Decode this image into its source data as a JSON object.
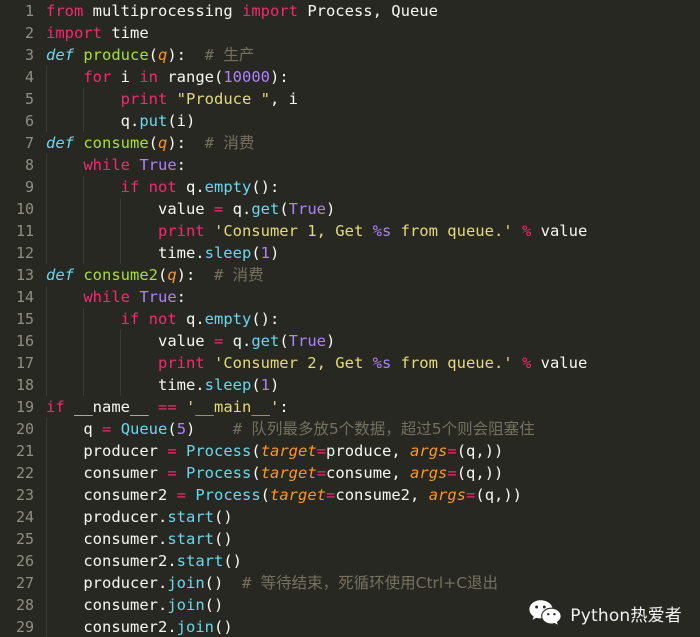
{
  "app": {
    "kind": "code-editor",
    "language": "Python",
    "theme": "Monokai",
    "background_color": "#272822",
    "foreground_color": "#f8f8f2",
    "gutter_color": "#8f8f84",
    "comment_color": "#75715e"
  },
  "palette": {
    "keyword": "#f92672",
    "def_keyword": "#66d9ef",
    "function_name": "#a6e22e",
    "parameter": "#fd971f",
    "class_name": "#66d9ef",
    "number": "#ae81ff",
    "string": "#e6db74",
    "comment": "#75715e",
    "plain": "#f8f8f2"
  },
  "watermark": {
    "icon": "wechat-icon",
    "label": "Python热爱者"
  },
  "editor": {
    "first_line_number": 1,
    "last_line_number": 29,
    "line_count": 29,
    "lines": [
      {
        "n": "1",
        "tokens": [
          {
            "t": "from ",
            "c": "kw"
          },
          {
            "t": "multiprocessing ",
            "c": "plain"
          },
          {
            "t": "import ",
            "c": "kw"
          },
          {
            "t": "Process, Queue",
            "c": "plain"
          }
        ]
      },
      {
        "n": "2",
        "tokens": [
          {
            "t": "import ",
            "c": "kw"
          },
          {
            "t": "time",
            "c": "plain"
          }
        ]
      },
      {
        "n": "3",
        "tokens": [
          {
            "t": "def ",
            "c": "kwdef"
          },
          {
            "t": "produce",
            "c": "fn"
          },
          {
            "t": "(",
            "c": "plain"
          },
          {
            "t": "q",
            "c": "param"
          },
          {
            "t": "):",
            "c": "plain"
          },
          {
            "t": "  # ",
            "c": "cmt"
          },
          {
            "t": "生产",
            "c": "cmt-cn"
          }
        ]
      },
      {
        "n": "4",
        "tokens": [
          {
            "t": "    ",
            "c": "plain"
          },
          {
            "t": "for ",
            "c": "kw"
          },
          {
            "t": "i ",
            "c": "plain"
          },
          {
            "t": "in ",
            "c": "kw"
          },
          {
            "t": "range",
            "c": "plain"
          },
          {
            "t": "(",
            "c": "plain"
          },
          {
            "t": "10000",
            "c": "num"
          },
          {
            "t": "):",
            "c": "plain"
          }
        ]
      },
      {
        "n": "5",
        "tokens": [
          {
            "t": "        ",
            "c": "plain"
          },
          {
            "t": "print ",
            "c": "kw"
          },
          {
            "t": "\"Produce \"",
            "c": "str"
          },
          {
            "t": ", i",
            "c": "plain"
          }
        ]
      },
      {
        "n": "6",
        "tokens": [
          {
            "t": "        q.",
            "c": "plain"
          },
          {
            "t": "put",
            "c": "meth"
          },
          {
            "t": "(i)",
            "c": "plain"
          }
        ]
      },
      {
        "n": "7",
        "tokens": [
          {
            "t": "def ",
            "c": "kwdef"
          },
          {
            "t": "consume",
            "c": "fn"
          },
          {
            "t": "(",
            "c": "plain"
          },
          {
            "t": "q",
            "c": "param"
          },
          {
            "t": "):",
            "c": "plain"
          },
          {
            "t": "  # ",
            "c": "cmt"
          },
          {
            "t": "消费",
            "c": "cmt-cn"
          }
        ]
      },
      {
        "n": "8",
        "tokens": [
          {
            "t": "    ",
            "c": "plain"
          },
          {
            "t": "while ",
            "c": "kw"
          },
          {
            "t": "True",
            "c": "num"
          },
          {
            "t": ":",
            "c": "plain"
          }
        ]
      },
      {
        "n": "9",
        "tokens": [
          {
            "t": "        ",
            "c": "plain"
          },
          {
            "t": "if ",
            "c": "kw"
          },
          {
            "t": "not ",
            "c": "kw"
          },
          {
            "t": "q.",
            "c": "plain"
          },
          {
            "t": "empty",
            "c": "meth"
          },
          {
            "t": "():",
            "c": "plain"
          }
        ]
      },
      {
        "n": "10",
        "tokens": [
          {
            "t": "            value ",
            "c": "plain"
          },
          {
            "t": "=",
            "c": "op"
          },
          {
            "t": " q.",
            "c": "plain"
          },
          {
            "t": "get",
            "c": "meth"
          },
          {
            "t": "(",
            "c": "plain"
          },
          {
            "t": "True",
            "c": "num"
          },
          {
            "t": ")",
            "c": "plain"
          }
        ]
      },
      {
        "n": "11",
        "tokens": [
          {
            "t": "            ",
            "c": "plain"
          },
          {
            "t": "print ",
            "c": "kw"
          },
          {
            "t": "'Consumer 1, Get ",
            "c": "str"
          },
          {
            "t": "%s",
            "c": "strfmt"
          },
          {
            "t": " from queue.'",
            "c": "str"
          },
          {
            "t": " ",
            "c": "plain"
          },
          {
            "t": "%",
            "c": "op"
          },
          {
            "t": " value",
            "c": "plain"
          }
        ]
      },
      {
        "n": "12",
        "tokens": [
          {
            "t": "            time.",
            "c": "plain"
          },
          {
            "t": "sleep",
            "c": "meth"
          },
          {
            "t": "(",
            "c": "plain"
          },
          {
            "t": "1",
            "c": "num"
          },
          {
            "t": ")",
            "c": "plain"
          }
        ]
      },
      {
        "n": "13",
        "tokens": [
          {
            "t": "def ",
            "c": "kwdef"
          },
          {
            "t": "consume2",
            "c": "fn"
          },
          {
            "t": "(",
            "c": "plain"
          },
          {
            "t": "q",
            "c": "param"
          },
          {
            "t": "):",
            "c": "plain"
          },
          {
            "t": "  # ",
            "c": "cmt"
          },
          {
            "t": "消费",
            "c": "cmt-cn"
          }
        ]
      },
      {
        "n": "14",
        "tokens": [
          {
            "t": "    ",
            "c": "plain"
          },
          {
            "t": "while ",
            "c": "kw"
          },
          {
            "t": "True",
            "c": "num"
          },
          {
            "t": ":",
            "c": "plain"
          }
        ]
      },
      {
        "n": "15",
        "tokens": [
          {
            "t": "        ",
            "c": "plain"
          },
          {
            "t": "if ",
            "c": "kw"
          },
          {
            "t": "not ",
            "c": "kw"
          },
          {
            "t": "q.",
            "c": "plain"
          },
          {
            "t": "empty",
            "c": "meth"
          },
          {
            "t": "():",
            "c": "plain"
          }
        ]
      },
      {
        "n": "16",
        "tokens": [
          {
            "t": "            value ",
            "c": "plain"
          },
          {
            "t": "=",
            "c": "op"
          },
          {
            "t": " q.",
            "c": "plain"
          },
          {
            "t": "get",
            "c": "meth"
          },
          {
            "t": "(",
            "c": "plain"
          },
          {
            "t": "True",
            "c": "num"
          },
          {
            "t": ")",
            "c": "plain"
          }
        ]
      },
      {
        "n": "17",
        "tokens": [
          {
            "t": "            ",
            "c": "plain"
          },
          {
            "t": "print ",
            "c": "kw"
          },
          {
            "t": "'Consumer 2, Get ",
            "c": "str"
          },
          {
            "t": "%s",
            "c": "strfmt"
          },
          {
            "t": " from queue.'",
            "c": "str"
          },
          {
            "t": " ",
            "c": "plain"
          },
          {
            "t": "%",
            "c": "op"
          },
          {
            "t": " value",
            "c": "plain"
          }
        ]
      },
      {
        "n": "18",
        "tokens": [
          {
            "t": "            time.",
            "c": "plain"
          },
          {
            "t": "sleep",
            "c": "meth"
          },
          {
            "t": "(",
            "c": "plain"
          },
          {
            "t": "1",
            "c": "num"
          },
          {
            "t": ")",
            "c": "plain"
          }
        ]
      },
      {
        "n": "19",
        "tokens": [
          {
            "t": "if ",
            "c": "kw"
          },
          {
            "t": "__name__ ",
            "c": "plain"
          },
          {
            "t": "==",
            "c": "op"
          },
          {
            "t": " ",
            "c": "plain"
          },
          {
            "t": "'__main__'",
            "c": "str"
          },
          {
            "t": ":",
            "c": "plain"
          }
        ]
      },
      {
        "n": "20",
        "tokens": [
          {
            "t": "    q ",
            "c": "plain"
          },
          {
            "t": "=",
            "c": "op"
          },
          {
            "t": " ",
            "c": "plain"
          },
          {
            "t": "Queue",
            "c": "cls"
          },
          {
            "t": "(",
            "c": "plain"
          },
          {
            "t": "5",
            "c": "num"
          },
          {
            "t": ")",
            "c": "plain"
          },
          {
            "t": "    # ",
            "c": "cmt"
          },
          {
            "t": "队列最多放5个数据，超过5个则会阻塞住",
            "c": "cmt-cn"
          }
        ]
      },
      {
        "n": "21",
        "tokens": [
          {
            "t": "    producer ",
            "c": "plain"
          },
          {
            "t": "=",
            "c": "op"
          },
          {
            "t": " ",
            "c": "plain"
          },
          {
            "t": "Process",
            "c": "cls"
          },
          {
            "t": "(",
            "c": "plain"
          },
          {
            "t": "target",
            "c": "param"
          },
          {
            "t": "=",
            "c": "op"
          },
          {
            "t": "produce, ",
            "c": "plain"
          },
          {
            "t": "args",
            "c": "param"
          },
          {
            "t": "=",
            "c": "op"
          },
          {
            "t": "(q,))",
            "c": "plain"
          }
        ]
      },
      {
        "n": "22",
        "tokens": [
          {
            "t": "    consumer ",
            "c": "plain"
          },
          {
            "t": "=",
            "c": "op"
          },
          {
            "t": " ",
            "c": "plain"
          },
          {
            "t": "Process",
            "c": "cls"
          },
          {
            "t": "(",
            "c": "plain"
          },
          {
            "t": "target",
            "c": "param"
          },
          {
            "t": "=",
            "c": "op"
          },
          {
            "t": "consume, ",
            "c": "plain"
          },
          {
            "t": "args",
            "c": "param"
          },
          {
            "t": "=",
            "c": "op"
          },
          {
            "t": "(q,))",
            "c": "plain"
          }
        ]
      },
      {
        "n": "23",
        "tokens": [
          {
            "t": "    consumer2 ",
            "c": "plain"
          },
          {
            "t": "=",
            "c": "op"
          },
          {
            "t": " ",
            "c": "plain"
          },
          {
            "t": "Process",
            "c": "cls"
          },
          {
            "t": "(",
            "c": "plain"
          },
          {
            "t": "target",
            "c": "param"
          },
          {
            "t": "=",
            "c": "op"
          },
          {
            "t": "consume2, ",
            "c": "plain"
          },
          {
            "t": "args",
            "c": "param"
          },
          {
            "t": "=",
            "c": "op"
          },
          {
            "t": "(q,))",
            "c": "plain"
          }
        ]
      },
      {
        "n": "24",
        "tokens": [
          {
            "t": "    producer.",
            "c": "plain"
          },
          {
            "t": "start",
            "c": "meth"
          },
          {
            "t": "()",
            "c": "plain"
          }
        ]
      },
      {
        "n": "25",
        "tokens": [
          {
            "t": "    consumer.",
            "c": "plain"
          },
          {
            "t": "start",
            "c": "meth"
          },
          {
            "t": "()",
            "c": "plain"
          }
        ]
      },
      {
        "n": "26",
        "tokens": [
          {
            "t": "    consumer2.",
            "c": "plain"
          },
          {
            "t": "start",
            "c": "meth"
          },
          {
            "t": "()",
            "c": "plain"
          }
        ]
      },
      {
        "n": "27",
        "tokens": [
          {
            "t": "    producer.",
            "c": "plain"
          },
          {
            "t": "join",
            "c": "meth"
          },
          {
            "t": "()",
            "c": "plain"
          },
          {
            "t": "  # ",
            "c": "cmt"
          },
          {
            "t": "等待结束，死循环使用Ctrl+C退出",
            "c": "cmt-cn"
          }
        ]
      },
      {
        "n": "28",
        "tokens": [
          {
            "t": "    consumer.",
            "c": "plain"
          },
          {
            "t": "join",
            "c": "meth"
          },
          {
            "t": "()",
            "c": "plain"
          }
        ]
      },
      {
        "n": "29",
        "tokens": [
          {
            "t": "    consumer2.",
            "c": "plain"
          },
          {
            "t": "join",
            "c": "meth"
          },
          {
            "t": "()",
            "c": "plain"
          }
        ]
      }
    ]
  }
}
